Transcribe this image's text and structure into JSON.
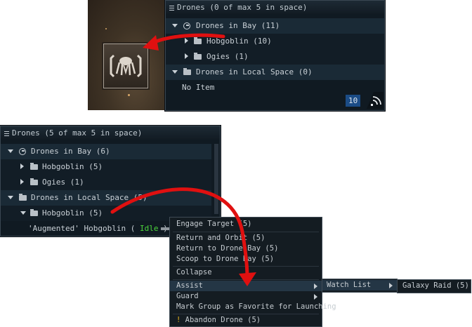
{
  "top_window": {
    "title": "Drones (0 of max 5 in space)",
    "rows": [
      {
        "label": "Drones in Bay",
        "count": "(11)"
      },
      {
        "label": "Hobgoblin",
        "count": "(10)"
      },
      {
        "label": "Ogies",
        "count": "(1)"
      },
      {
        "label": "Drones in Local Space",
        "count": "(0)"
      }
    ],
    "empty_text": "No Item",
    "badge": "10"
  },
  "bottom_window": {
    "title": "Drones (5 of max 5 in space)",
    "rows": [
      {
        "label": "Drones in Bay",
        "count": "(6)"
      },
      {
        "label": "Hobgoblin",
        "count": "(5)"
      },
      {
        "label": "Ogies",
        "count": "(1)"
      },
      {
        "label": "Drones in Local Space",
        "count": "(5)"
      },
      {
        "label": "Hobgoblin",
        "count": "(5)"
      }
    ],
    "drone_item": {
      "name": "'Augmented' Hobgoblin",
      "open": "(",
      "status": "Idle",
      "close": ")"
    }
  },
  "context_menu": {
    "items": {
      "engage": "Engage Target (5)",
      "orbit": "Return and Orbit (5)",
      "return_bay": "Return to Drone Bay (5)",
      "scoop": "Scoop to Drone Bay (5)",
      "collapse": "Collapse",
      "assist": "Assist",
      "guard": "Guard",
      "favorite": "Mark Group as Favorite for Launching",
      "abandon_mark": "!",
      "abandon": "Abandon Drone (5)"
    }
  },
  "submenu": {
    "watch_list": "Watch List"
  },
  "submenu2": {
    "galaxy_raid": "Galaxy Raid (5)"
  },
  "colors": {
    "accent_arrow": "#e01010",
    "idle_green": "#4cd43c",
    "badge_blue": "#1b4c86"
  },
  "icons": [
    "list-menu-icon",
    "cycle-icon",
    "folder-icon",
    "expand-arrow-icon",
    "collapse-arrow-icon",
    "signal-icon",
    "drone-icon"
  ]
}
